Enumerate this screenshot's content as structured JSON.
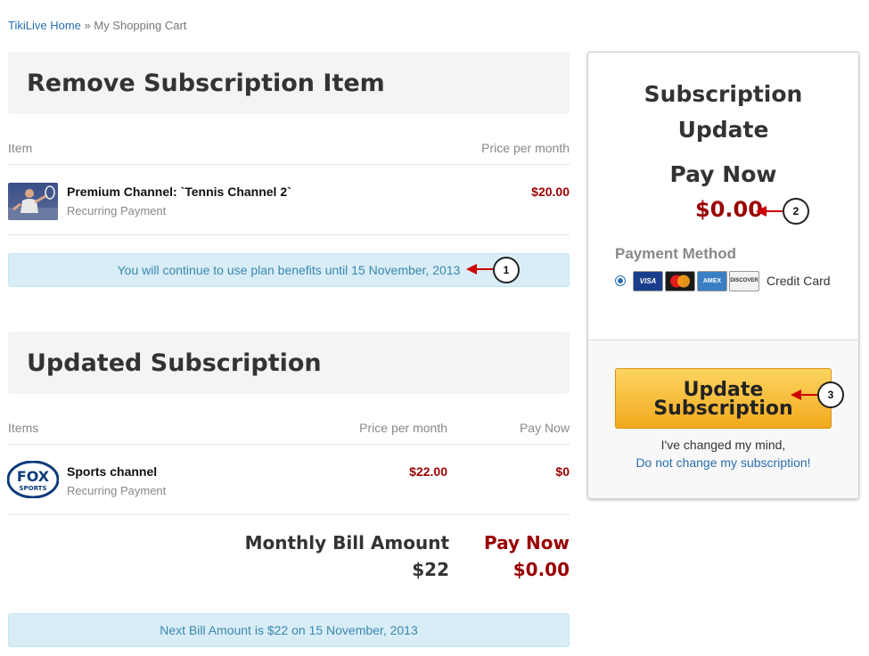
{
  "breadcrumb": {
    "home": "TikiLive Home",
    "separator": "»",
    "current": "My Shopping Cart"
  },
  "remove_section": {
    "title": "Remove Subscription Item",
    "col_item": "Item",
    "col_price": "Price per month",
    "item": {
      "name": "Premium Channel:  `Tennis Channel 2`",
      "sub": "Recurring Payment",
      "price": "$20.00",
      "thumb_icon": "tennis-player-thumbnail"
    },
    "notice": "You will continue to use plan benefits until 15 November, 2013"
  },
  "updated_section": {
    "title": "Updated Subscription",
    "col_items": "Items",
    "col_price": "Price per month",
    "col_paynow": "Pay Now",
    "item": {
      "name": "Sports channel",
      "sub": "Recurring Payment",
      "price": "$22.00",
      "paynow": "$0",
      "logo_text": "FOX",
      "logo_sub": "SPORTS"
    },
    "monthly_label": "Monthly Bill Amount",
    "monthly_value": "$22",
    "paynow_label": "Pay Now",
    "paynow_value": "$0.00",
    "notice": "Next Bill Amount is $22 on 15 November, 2013"
  },
  "sidebar": {
    "title_line1": "Subscription",
    "title_line2": "Update",
    "paynow_label": "Pay Now",
    "paynow_value": "$0.00",
    "payment_method_label": "Payment Method",
    "cards": [
      "VISA",
      "MC",
      "AMEX",
      "DISCOVER"
    ],
    "credit_card_label": "Credit Card",
    "button_line1": "Update",
    "button_line2": "Subscription",
    "changed_mind": "I've changed my mind,",
    "do_not_change": "Do not change my subscription!"
  },
  "callouts": [
    "1",
    "2",
    "3"
  ],
  "colors": {
    "accent_red": "#9a0000",
    "link_blue": "#2a6fb0",
    "alert_bg": "#d9edf7",
    "button_gold": "#f6bd3a",
    "callout_arrow": "#cc0000"
  }
}
